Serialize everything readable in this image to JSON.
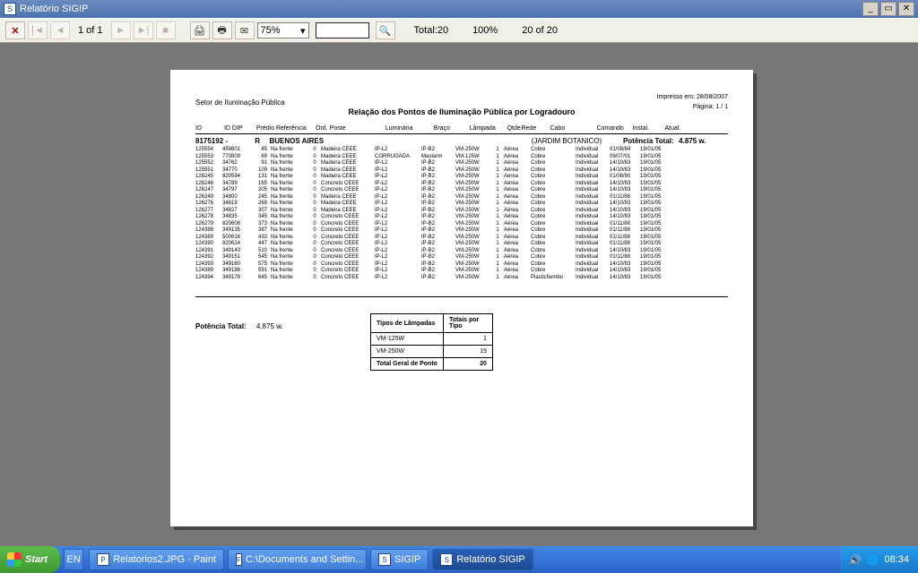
{
  "window": {
    "title": "Relatório SIGIP"
  },
  "toolbar": {
    "page_of": "1 of 1",
    "zoom": "75%",
    "total_label": "Total:20",
    "pct": "100%",
    "count": "20 of 20"
  },
  "report": {
    "setor": "Setor de Iluminação Pública",
    "impresso": "Impresso em:   28/08/2007",
    "pagina": "Página:   1  /  1",
    "title": "Relação dos  Pontos de Iluminação Pública por Logradouro",
    "cols": [
      "ID",
      "ID DIP",
      "Prédio",
      "Referência",
      "Ord.",
      "Poste",
      "Luminária",
      "Braço",
      "Lâmpada",
      "Qtde.",
      "Rede",
      "Cabo",
      "Comando",
      "Instal.",
      "Atual."
    ],
    "group": {
      "code": "8175192  -",
      "tipo": "R",
      "nome": "BUENOS AIRES",
      "extra": "(JARDIM BOTANICO)",
      "pot_label": "Potência Total:",
      "pot": "4.875  w."
    },
    "rows": [
      {
        "id": "125554",
        "idp": "459801",
        "pred": "45",
        "ref": "Na frente",
        "ord": "0",
        "poste": "Madeira CEEE",
        "lum": "IP-L2",
        "braco": "IP-B2",
        "lamp": "VM-250W",
        "qt": "1",
        "rede": "Aérea",
        "cabo": "Cobre",
        "cmd": "Individual",
        "inst": "01/08/84",
        "atu": "19/01/05"
      },
      {
        "id": "125553",
        "idp": "770809",
        "pred": "69",
        "ref": "Na frente",
        "ord": "0",
        "poste": "Madeira CEEE",
        "lum": "CORRUGADA",
        "braco": "Mastarm",
        "lamp": "VM-125W",
        "qt": "1",
        "rede": "Aérea",
        "cabo": "Cobre",
        "cmd": "Individual",
        "inst": "09/07/01",
        "atu": "19/01/05"
      },
      {
        "id": "125552",
        "idp": "34762",
        "pred": "91",
        "ref": "Na frente",
        "ord": "0",
        "poste": "Madeira CEEE",
        "lum": "IP-L2",
        "braco": "IP-B2",
        "lamp": "VM-250W",
        "qt": "1",
        "rede": "Aérea",
        "cabo": "Cobre",
        "cmd": "Individual",
        "inst": "14/10/83",
        "atu": "19/01/05"
      },
      {
        "id": "125551",
        "idp": "34770",
        "pred": "109",
        "ref": "Na frente",
        "ord": "0",
        "poste": "Madeira CEEE",
        "lum": "IP-L2",
        "braco": "IP-B2",
        "lamp": "VM-250W",
        "qt": "1",
        "rede": "Aérea",
        "cabo": "Cobre",
        "cmd": "Individual",
        "inst": "14/10/83",
        "atu": "19/01/05"
      },
      {
        "id": "126245",
        "idp": "820594",
        "pred": "131",
        "ref": "Na frente",
        "ord": "0",
        "poste": "Madeira CEEE",
        "lum": "IP-L2",
        "braco": "IP-B2",
        "lamp": "VM-250W",
        "qt": "1",
        "rede": "Aérea",
        "cabo": "Cobre",
        "cmd": "Individual",
        "inst": "01/08/90",
        "atu": "19/01/05"
      },
      {
        "id": "126246",
        "idp": "34789",
        "pred": "165",
        "ref": "Na frente",
        "ord": "0",
        "poste": "Concreto CEEE",
        "lum": "IP-L2",
        "braco": "IP-B2",
        "lamp": "VM-250W",
        "qt": "1",
        "rede": "Aérea",
        "cabo": "Cobre",
        "cmd": "Individual",
        "inst": "14/10/83",
        "atu": "19/01/05"
      },
      {
        "id": "126247",
        "idp": "34797",
        "pred": "205",
        "ref": "Na frente",
        "ord": "0",
        "poste": "Concreto CEEE",
        "lum": "IP-L2",
        "braco": "IP-B2",
        "lamp": "VM-250W",
        "qt": "1",
        "rede": "Aérea",
        "cabo": "Cobre",
        "cmd": "Individual",
        "inst": "14/10/83",
        "atu": "19/01/05"
      },
      {
        "id": "126249",
        "idp": "34800",
        "pred": "245",
        "ref": "Na frente",
        "ord": "0",
        "poste": "Madeira CEEE",
        "lum": "IP-L2",
        "braco": "IP-B2",
        "lamp": "VM-250W",
        "qt": "1",
        "rede": "Aérea",
        "cabo": "Cobre",
        "cmd": "Individual",
        "inst": "01/11/88",
        "atu": "19/01/05"
      },
      {
        "id": "126276",
        "idp": "34819",
        "pred": "269",
        "ref": "Na frente",
        "ord": "0",
        "poste": "Madeira CEEE",
        "lum": "IP-L2",
        "braco": "IP-B2",
        "lamp": "VM-250W",
        "qt": "1",
        "rede": "Aérea",
        "cabo": "Cobre",
        "cmd": "Individual",
        "inst": "14/10/83",
        "atu": "19/01/05"
      },
      {
        "id": "126277",
        "idp": "34827",
        "pred": "307",
        "ref": "Na frente",
        "ord": "0",
        "poste": "Madeira CEEE",
        "lum": "IP-L2",
        "braco": "IP-B2",
        "lamp": "VM-250W",
        "qt": "1",
        "rede": "Aérea",
        "cabo": "Cobre",
        "cmd": "Individual",
        "inst": "14/10/83",
        "atu": "19/01/05"
      },
      {
        "id": "126278",
        "idp": "34835",
        "pred": "345",
        "ref": "Na frente",
        "ord": "0",
        "poste": "Concreto CEEE",
        "lum": "IP-L2",
        "braco": "IP-B2",
        "lamp": "VM-250W",
        "qt": "1",
        "rede": "Aérea",
        "cabo": "Cobre",
        "cmd": "Individual",
        "inst": "14/10/83",
        "atu": "19/01/05"
      },
      {
        "id": "126279",
        "idp": "820608",
        "pred": "373",
        "ref": "Na frente",
        "ord": "0",
        "poste": "Concreto CEEE",
        "lum": "IP-L2",
        "braco": "IP-B2",
        "lamp": "VM-250W",
        "qt": "1",
        "rede": "Aérea",
        "cabo": "Cobre",
        "cmd": "Individual",
        "inst": "01/11/88",
        "atu": "19/01/05"
      },
      {
        "id": "124388",
        "idp": "349135",
        "pred": "397",
        "ref": "Na frente",
        "ord": "0",
        "poste": "Concreto CEEE",
        "lum": "IP-L2",
        "braco": "IP-B2",
        "lamp": "VM-250W",
        "qt": "1",
        "rede": "Aérea",
        "cabo": "Cobre",
        "cmd": "Individual",
        "inst": "01/11/88",
        "atu": "19/01/05"
      },
      {
        "id": "124389",
        "idp": "500616",
        "pred": "433",
        "ref": "Na frente",
        "ord": "0",
        "poste": "Concreto CEEE",
        "lum": "IP-L2",
        "braco": "IP-B2",
        "lamp": "VM-250W",
        "qt": "1",
        "rede": "Aérea",
        "cabo": "Cobre",
        "cmd": "Individual",
        "inst": "01/11/88",
        "atu": "19/01/05"
      },
      {
        "id": "124390",
        "idp": "820624",
        "pred": "447",
        "ref": "Na frente",
        "ord": "0",
        "poste": "Concreto CEEE",
        "lum": "IP-L2",
        "braco": "IP-B2",
        "lamp": "VM-250W",
        "qt": "1",
        "rede": "Aérea",
        "cabo": "Cobre",
        "cmd": "Individual",
        "inst": "01/11/88",
        "atu": "19/01/05"
      },
      {
        "id": "124391",
        "idp": "349143",
        "pred": "510",
        "ref": "Na frente",
        "ord": "0",
        "poste": "Concreto CEEE",
        "lum": "IP-L2",
        "braco": "IP-B2",
        "lamp": "VM-250W",
        "qt": "1",
        "rede": "Aérea",
        "cabo": "Cobre",
        "cmd": "Individual",
        "inst": "14/10/83",
        "atu": "19/01/05"
      },
      {
        "id": "124392",
        "idp": "349151",
        "pred": "545",
        "ref": "Na frente",
        "ord": "0",
        "poste": "Concreto CEEE",
        "lum": "IP-L2",
        "braco": "IP-B2",
        "lamp": "VM-250W",
        "qt": "1",
        "rede": "Aérea",
        "cabo": "Cobre",
        "cmd": "Individual",
        "inst": "01/11/88",
        "atu": "19/01/05"
      },
      {
        "id": "124393",
        "idp": "349160",
        "pred": "575",
        "ref": "Na frente",
        "ord": "0",
        "poste": "Concreto CEEE",
        "lum": "IP-L2",
        "braco": "IP-B2",
        "lamp": "VM-250W",
        "qt": "1",
        "rede": "Aérea",
        "cabo": "Cobre",
        "cmd": "Individual",
        "inst": "14/10/83",
        "atu": "19/01/05"
      },
      {
        "id": "124389",
        "idp": "349186",
        "pred": "591",
        "ref": "Na frente",
        "ord": "0",
        "poste": "Concreto CEEE",
        "lum": "IP-L2",
        "braco": "IP-B2",
        "lamp": "VM-250W",
        "qt": "1",
        "rede": "Aérea",
        "cabo": "Cobre",
        "cmd": "Individual",
        "inst": "14/10/83",
        "atu": "19/01/05"
      },
      {
        "id": "124394",
        "idp": "349178",
        "pred": "645",
        "ref": "Na frente",
        "ord": "0",
        "poste": "Concreto CEEE",
        "lum": "IP-L2",
        "braco": "IP-B2",
        "lamp": "VM-250W",
        "qt": "1",
        "rede": "Aérea",
        "cabo": "Plastichumbo",
        "cmd": "Individual",
        "inst": "14/10/83",
        "atu": "19/01/05"
      }
    ],
    "footer": {
      "pot_label": "Potência Total:",
      "pot": "4.875  w.",
      "col_tipos": "Tipos de Lâmpadas",
      "col_tot": "Totais por Tipo",
      "items": [
        {
          "tipo": "VM-125W",
          "tot": "1"
        },
        {
          "tipo": "VM-250W",
          "tot": "19"
        }
      ],
      "grand_label": "Total Geral de Ponto",
      "grand": "20"
    }
  },
  "taskbar": {
    "start": "Start",
    "tasks": [
      {
        "label": "Relatorios2.JPG - Paint",
        "icon": "P"
      },
      {
        "label": "C:\\Documents and Settin...",
        "icon": "F"
      },
      {
        "label": "SIGIP",
        "icon": "S"
      },
      {
        "label": "Relatório SIGIP",
        "icon": "S",
        "active": true
      }
    ],
    "clock": "08:34"
  }
}
